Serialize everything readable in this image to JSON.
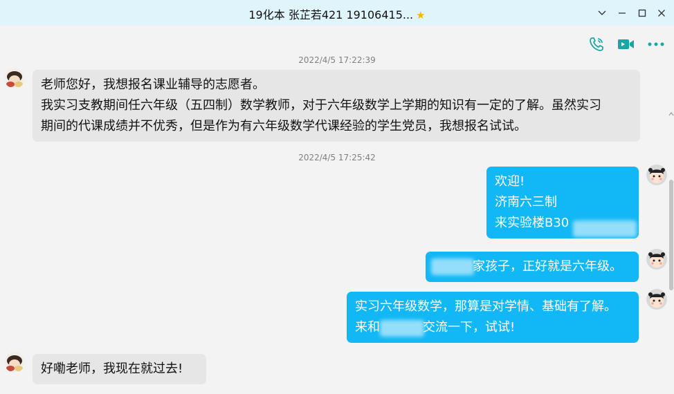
{
  "window": {
    "title": "19化本 张芷若421 19106415...",
    "star_glyph": "★",
    "minimize_glyph": "﹀",
    "restore_glyph": "—",
    "maximize_glyph": "☐",
    "close_glyph": "✕"
  },
  "toolbar": {
    "accent": "#1aa6a6"
  },
  "messages": [
    {
      "timestamp": "2022/4/5 17:22:39"
    },
    {
      "direction": "in",
      "lines": [
        "老师您好，我想报名课业辅导的志愿者。",
        "我实习支教期间任六年级（五四制）数学教师，对于六年级数学上学期的知识有一定的了解。虽然实习",
        "期间的代课成绩并不优秀，但是作为有六年级数学代课经验的学生党员，我想报名试试。"
      ]
    },
    {
      "timestamp": "2022/4/5 17:25:42"
    },
    {
      "direction": "out",
      "lines": [
        "欢迎!",
        "济南六三制",
        "来实验楼B30"
      ]
    },
    {
      "direction": "out",
      "lines": [
        "家孩子，正好就是六年级。"
      ]
    },
    {
      "direction": "out",
      "lines": [
        "实习六年级数学，那算是对学情、基础有了解。",
        "来和",
        "交流一下，试试!"
      ]
    },
    {
      "direction": "in",
      "lines": [
        "好嘞老师，我现在就过去!"
      ]
    }
  ],
  "colors": {
    "incoming_bubble": "#e6e6e6",
    "outgoing_bubble": "#12b7f5",
    "titlebar": "#dff4fb",
    "background": "#f3f3f3"
  }
}
